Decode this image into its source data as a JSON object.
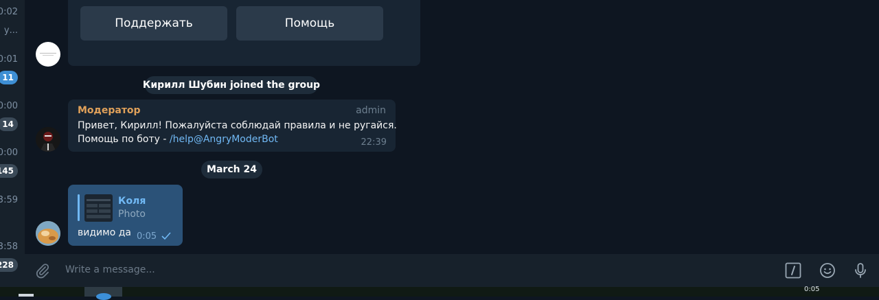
{
  "sidebar": {
    "times": [
      "0:02",
      "у...",
      "0:01",
      "0:00",
      "0:00",
      "3:59",
      "3:58"
    ],
    "badges": [
      "11",
      "14",
      "145",
      "228"
    ]
  },
  "keyboard": {
    "buttons": [
      "Поддержать",
      "Помощь"
    ]
  },
  "service_join": "Кирилл Шубин joined the group",
  "moderator_message": {
    "sender": "Модератор",
    "role": "admin",
    "line1": "Привет, Кирилл! Пожалуйста соблюдай правила и не ругайся.",
    "line2_prefix": "Помощь по боту - ",
    "line2_link": "/help@AngryModerBot",
    "time": "22:39"
  },
  "date_divider": "March 24",
  "outgoing_message": {
    "reply_name": "Коля",
    "reply_type": "Photo",
    "text": "видимо да",
    "time": "0:05",
    "status": "sent"
  },
  "composer": {
    "placeholder": "Write a message..."
  },
  "taskbar": {
    "clock": "0:05"
  },
  "colors": {
    "background": "#0e1621",
    "bubble_in": "#182533",
    "bubble_out": "#2b5278",
    "accent": "#71b9f5",
    "sender_name": "#e0a15a"
  }
}
